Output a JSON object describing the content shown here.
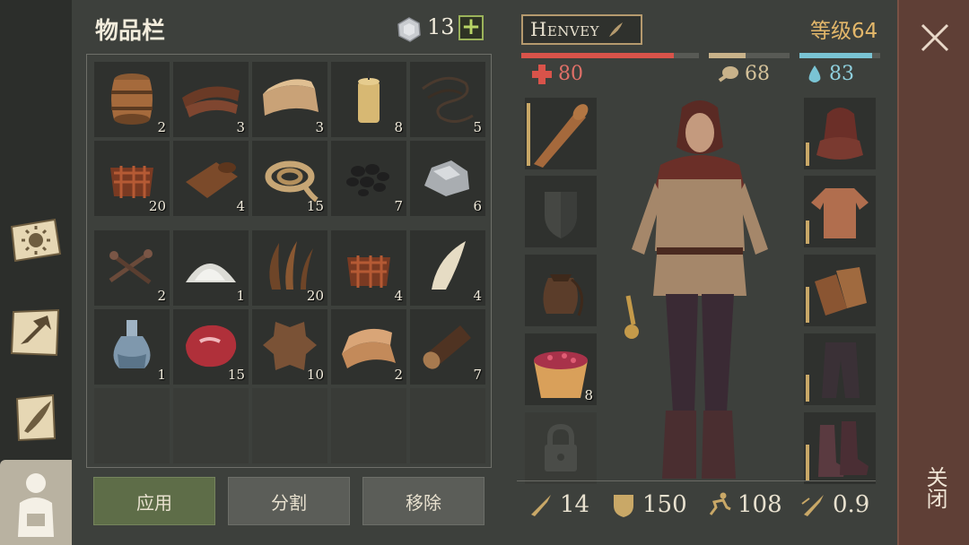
{
  "inventory": {
    "title": "物品栏",
    "coins": "13",
    "plus_label": "+",
    "slots": [
      {
        "icon": "barrel-icon",
        "count": "2"
      },
      {
        "icon": "leather-strips-icon",
        "count": "3"
      },
      {
        "icon": "cloth-icon",
        "count": "3"
      },
      {
        "icon": "candle-icon",
        "count": "8"
      },
      {
        "icon": "thread-icon",
        "count": "5"
      },
      {
        "icon": "bark-fiber-icon",
        "count": "20"
      },
      {
        "icon": "leather-roll-icon",
        "count": "4"
      },
      {
        "icon": "rope-icon",
        "count": "15"
      },
      {
        "icon": "coal-icon",
        "count": "7"
      },
      {
        "icon": "ore-icon",
        "count": "6"
      },
      {
        "icon": "nails-icon",
        "count": "2"
      },
      {
        "icon": "salt-pile-icon",
        "count": "1"
      },
      {
        "icon": "plant-fiber-icon",
        "count": "20"
      },
      {
        "icon": "bark-fiber-icon",
        "count": "4"
      },
      {
        "icon": "fang-icon",
        "count": "4"
      },
      {
        "icon": "flask-icon",
        "count": "1"
      },
      {
        "icon": "raw-meat-icon",
        "count": "15"
      },
      {
        "icon": "hide-icon",
        "count": "10"
      },
      {
        "icon": "linen-icon",
        "count": "2"
      },
      {
        "icon": "log-icon",
        "count": "7"
      }
    ],
    "buttons": {
      "apply": "应用",
      "split": "分割",
      "remove": "移除"
    }
  },
  "character": {
    "name": "Henvey",
    "level": "等级64",
    "health": "80",
    "food": "68",
    "water": "83",
    "health_fraction": 0.86,
    "food_fraction": 0.45,
    "water_fraction": 0.9,
    "bowl_count": "8",
    "stats": {
      "attack": "14",
      "armor": "150",
      "speed": "108",
      "attack_speed": "0.9"
    }
  },
  "close_label": "关闭",
  "colors": {
    "health": "#d9534a",
    "food": "#c8b28a",
    "water": "#7ac4d4",
    "accent": "#9bb35a",
    "level": "#e3b76a"
  }
}
